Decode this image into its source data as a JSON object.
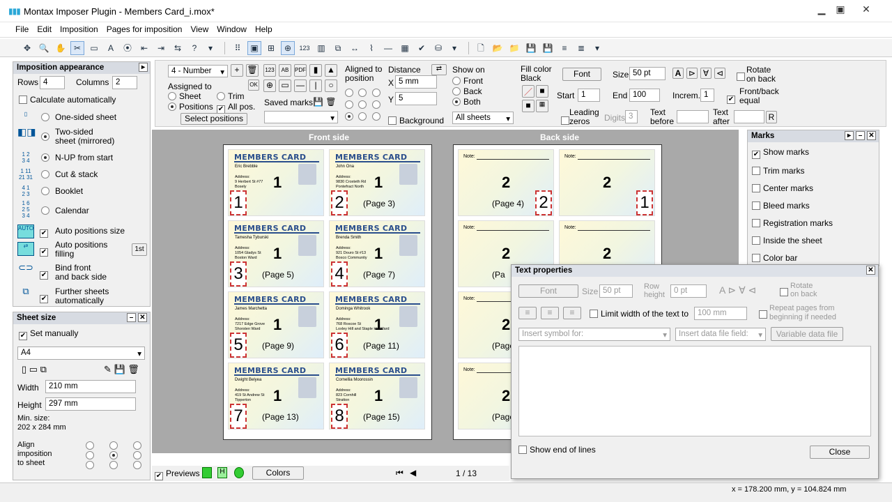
{
  "window": {
    "title": "Montax Imposer Plugin - Members Card_i.mox*"
  },
  "menu": [
    "File",
    "Edit",
    "Imposition",
    "Pages for imposition",
    "View",
    "Window",
    "Help"
  ],
  "appearance": {
    "header": "Imposition appearance",
    "rows_label": "Rows",
    "rows": "4",
    "columns_label": "Columns",
    "columns": "2",
    "calc_auto": "Calculate automatically",
    "one_sided": "One-sided sheet",
    "two_sided": "Two-sided\nsheet (mirrored)",
    "nup": "N-UP from start",
    "cut_stack": "Cut & stack",
    "booklet": "Booklet",
    "calendar": "Calendar",
    "auto_size": "Auto positions size",
    "auto_fill": "Auto positions\nfilling",
    "first_btn": "1st",
    "bind_front": "Bind front\nand back side",
    "further": "Further sheets\nautomatically"
  },
  "sheet_size": {
    "header": "Sheet size",
    "set_manually": "Set manually",
    "format": "A4",
    "width_label": "Width",
    "width": "210 mm",
    "height_label": "Height",
    "height": "297 mm",
    "min_size": "Min. size:\n202 x 284 mm",
    "align": "Align\nimposition\nto sheet"
  },
  "options": {
    "number_select": "4 - Number",
    "assigned_to": "Assigned to",
    "sheet": "Sheet",
    "trim": "Trim",
    "positions": "Positions",
    "all_pos": "All pos.",
    "select_positions": "Select positions",
    "saved_marks": "Saved marks",
    "aligned_to": "Aligned to\nposition",
    "distance": "Distance",
    "x_label": "X",
    "x_val": "5 mm",
    "y_label": "Y",
    "y_val": "5",
    "background": "Background",
    "show_on": "Show on",
    "front": "Front",
    "back": "Back",
    "both": "Both",
    "all_sheets": "All sheets",
    "fill_color": "Fill color\nBlack",
    "font_btn": "Font",
    "size_label": "Size",
    "size_val": "50 pt",
    "rotate_back": "Rotate\non back",
    "start_label": "Start",
    "start_val": "1",
    "end_label": "End",
    "end_val": "100",
    "increm_label": "Increm.",
    "increm_val": "1",
    "front_back_equal": "Front/back\nequal",
    "leading_zeros": "Leading\nzeros",
    "digits_label": "Digits",
    "digits_val": "3",
    "text_before": "Text\nbefore",
    "text_after": "Text\nafter",
    "r_btn": "R",
    "ok_btn": "OK",
    "pdf": "PDF",
    "ab": "AB",
    "n123": "123"
  },
  "canvas": {
    "front_title": "Front side",
    "back_title": "Back side"
  },
  "cards": [
    {
      "name": "Eric Brebble",
      "addr": "Address:\n9 Herbert St #77\nBosely",
      "big": "1",
      "pg": "",
      "num": "1"
    },
    {
      "name": "John Ona",
      "addr": "Address:\n9830 Croxteth Rd\nPontefract North",
      "big": "1",
      "pg": "(Page 3)",
      "num": "2"
    },
    {
      "name": "Tamesha Tyburski",
      "addr": "Address:\n1054 Gladys St\nBoston Ward",
      "big": "1",
      "pg": "(Page 5)",
      "num": "3"
    },
    {
      "name": "Brenda Smith",
      "addr": "Address:\n921 Douro St #13\nBosco Community",
      "big": "1",
      "pg": "(Page 7)",
      "num": "4"
    },
    {
      "name": "James Marchetta",
      "addr": "Address:\n7217 Edge Grove\nShorsten Ward",
      "big": "1",
      "pg": "(Page 9)",
      "num": "5"
    },
    {
      "name": "Dominga Whitrook",
      "addr": "Address:\n768 Roscoe St\nLoxley Hill and Staple Hill Ward",
      "big": "1",
      "pg": "(Page 11)",
      "num": "6"
    },
    {
      "name": "Dwight Belyea",
      "addr": "Address:\n419 St Andrew St\nTipperton",
      "big": "1",
      "pg": "(Page 13)",
      "num": "7"
    },
    {
      "name": "Cornellia Moorossin",
      "addr": "Address:\n823 Cornhill\nStratton",
      "big": "1",
      "pg": "(Page 15)",
      "num": "8"
    }
  ],
  "back_cards": [
    {
      "note": "Note:",
      "big": "2",
      "pg": "(Page 4)",
      "num": "2"
    },
    {
      "note": "Note:",
      "big": "2",
      "pg": "",
      "num": "1"
    },
    {
      "note": "Note:",
      "big": "2",
      "pg": "(Pa",
      "num": ""
    },
    {
      "note": "Note:",
      "big": "2",
      "pg": "",
      "num": ""
    },
    {
      "note": "Note:",
      "big": "2",
      "pg": "(Page",
      "num": ""
    },
    {
      "note": "Note:",
      "big": "",
      "pg": "",
      "num": ""
    },
    {
      "note": "Note:",
      "big": "2",
      "pg": "(Page",
      "num": ""
    },
    {
      "note": "Note:",
      "big": "",
      "pg": "",
      "num": ""
    }
  ],
  "card_title": "MEMBERS CARD",
  "marks": {
    "header": "Marks",
    "items": [
      "Show marks",
      "Trim marks",
      "Center marks",
      "Bleed marks",
      "Registration marks",
      "Inside the sheet",
      "Color bar"
    ]
  },
  "text_props": {
    "title": "Text properties",
    "font": "Font",
    "size_label": "Size",
    "size_val": "50 pt",
    "row_height": "Row\nheight",
    "row_val": "0 pt",
    "rotate_back": "Rotate\non back",
    "limit": "Limit width of the text to",
    "limit_val": "100 mm",
    "repeat": "Repeat pages from\nbeginning if needed",
    "insert_symbol": "Insert symbol for:",
    "insert_field": "Insert data file field:",
    "variable": "Variable data file",
    "show_end": "Show end of lines",
    "close": "Close"
  },
  "bottom": {
    "previews": "Previews",
    "colors": "Colors",
    "page": "1 / 13"
  },
  "status": {
    "coords": "x = 178.200 mm, y = 104.824 mm"
  }
}
